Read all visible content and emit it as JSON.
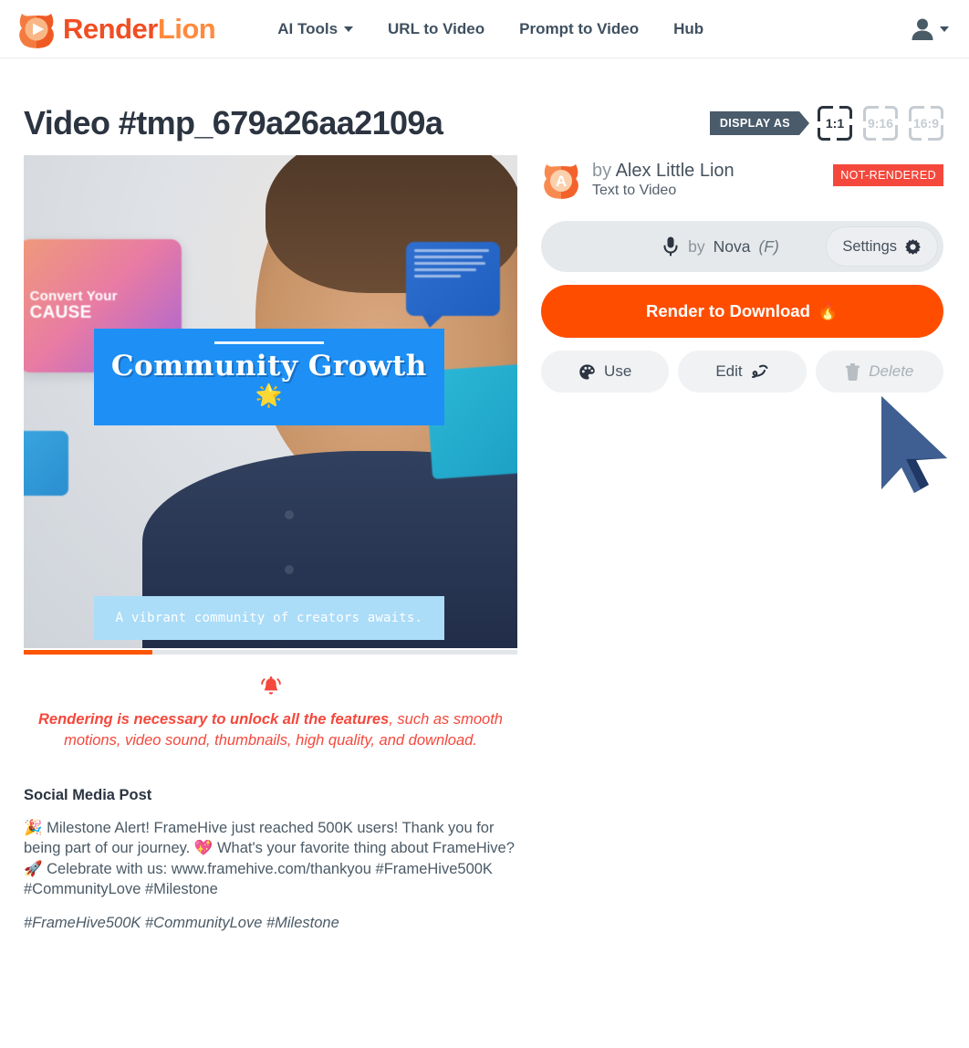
{
  "navbar": {
    "brand": {
      "part1": "Render",
      "part2": "Lion",
      "logo_icon": "lion-play-logo"
    },
    "links": [
      {
        "label": "AI Tools",
        "has_caret": true
      },
      {
        "label": "URL to Video",
        "has_caret": false
      },
      {
        "label": "Prompt to Video",
        "has_caret": false
      },
      {
        "label": "Hub",
        "has_caret": false
      }
    ],
    "user_icon": "user-avatar-icon"
  },
  "page": {
    "title": "Video #tmp_679a26aa2109a"
  },
  "display_as": {
    "tag_label": "DISPLAY AS",
    "options": [
      {
        "label": "1:1",
        "active": true
      },
      {
        "label": "9:16",
        "active": false
      },
      {
        "label": "16:9",
        "active": false
      }
    ]
  },
  "video": {
    "scene_card_line1": "Convert Your",
    "scene_card_line2": "CAUSE",
    "overlay_title": "Community Growth",
    "overlay_emoji": "🌟",
    "overlay_caption": "A vibrant community of creators awaits.",
    "progress_percent": 26
  },
  "warning": {
    "icon": "bell-icon",
    "bold_text": "Rendering is necessary to unlock all the features",
    "rest_text": ", such as smooth motions, video sound, thumbnails, high quality, and download."
  },
  "social": {
    "heading": "Social Media Post",
    "body": "🎉 Milestone Alert! FrameHive just reached 500K users! Thank you for being part of our journey. 💖 What's your favorite thing about FrameHive? 🚀 Celebrate with us: www.framehive.com/thankyou #FrameHive500K #CommunityLove #Milestone",
    "hashtags": "#FrameHive500K #CommunityLove #Milestone"
  },
  "author": {
    "avatar_icon": "lion-avatar-icon",
    "avatar_letter": "A",
    "by_label": "by",
    "name": "Alex Little Lion",
    "subtitle": "Text to Video",
    "status": "NOT-RENDERED"
  },
  "voice": {
    "mic_icon": "microphone-icon",
    "by_label": "by",
    "name": "Nova",
    "gender": "(F)",
    "settings_label": "Settings",
    "settings_icon": "gear-icon"
  },
  "actions": {
    "render_label": "Render to Download",
    "render_icon": "🔥",
    "use_label": "Use",
    "use_icon": "palette-icon",
    "edit_label": "Edit",
    "edit_icon": "squiggle-icon",
    "delete_label": "Delete",
    "delete_icon": "trash-icon"
  },
  "colors": {
    "brand_orange_dark": "#f04e23",
    "brand_orange_light": "#ff8a3d",
    "render_button": "#ff4d00",
    "status_red": "#f4483c",
    "nav_text": "#3f5060",
    "title_text": "#2b3440",
    "overlay_blue": "#1e90f5",
    "caption_blue": "#abdcf8",
    "cursor_navy": "#1f3864"
  }
}
